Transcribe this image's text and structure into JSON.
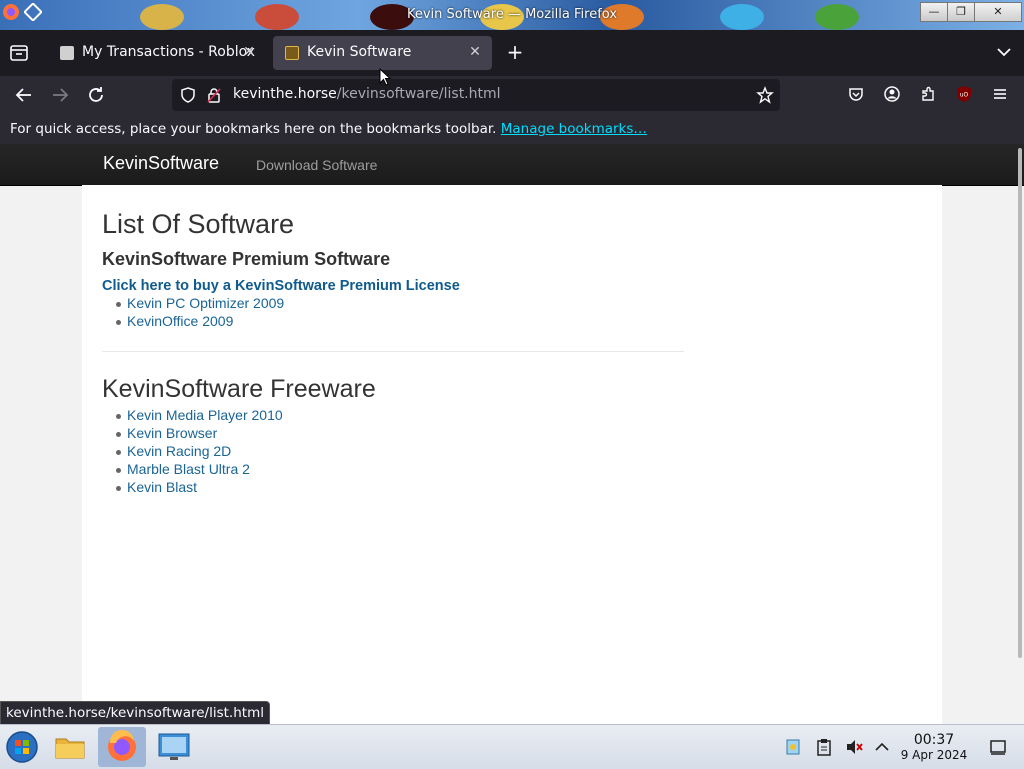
{
  "window": {
    "title": "Kevin Software — Mozilla Firefox"
  },
  "tabs": [
    {
      "label": "My Transactions - Roblox",
      "active": false
    },
    {
      "label": "Kevin Software",
      "active": true
    }
  ],
  "urlbar": {
    "domain": "kevinthe.horse",
    "path": "/kevinsoftware/list.html"
  },
  "bookmarks_bar": {
    "message": "For quick access, place your bookmarks here on the bookmarks toolbar.",
    "link": "Manage bookmarks…"
  },
  "site": {
    "brand": "KevinSoftware",
    "nav_link": "Download Software",
    "heading": "List Of Software",
    "premium_heading": "KevinSoftware Premium Software",
    "buy_link": "Click here to buy a KevinSoftware Premium License",
    "premium_items": [
      "Kevin PC Optimizer 2009",
      "KevinOffice 2009"
    ],
    "freeware_heading": "KevinSoftware Freeware",
    "freeware_items": [
      "Kevin Media Player 2010",
      "Kevin Browser",
      "Kevin Racing 2D",
      "Marble Blast Ultra 2",
      "Kevin Blast"
    ]
  },
  "status_bar": {
    "url": "kevinthe.horse/kevinsoftware/list.html"
  },
  "taskbar": {
    "time": "00:37",
    "date": "9 Apr 2024"
  },
  "colors": {
    "link": "#1a6496",
    "buy_link": "#0f5b8e",
    "bookmark_link": "#00ddff"
  }
}
